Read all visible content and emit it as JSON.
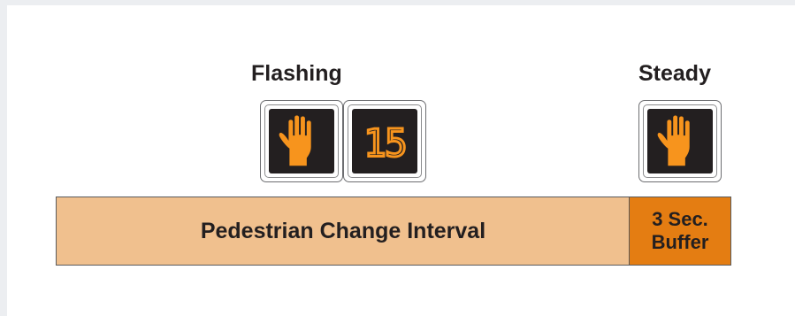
{
  "labels": {
    "flashing": "Flashing",
    "steady": "Steady"
  },
  "countdown": {
    "value": "15"
  },
  "bars": {
    "change_interval": "Pedestrian Change Interval",
    "buffer_line1": "3 Sec.",
    "buffer_line2": "Buffer"
  },
  "colors": {
    "signal_face": "#231f20",
    "indication": "#f7941d",
    "change_interval": "#f0c08e",
    "buffer": "#e47d12"
  },
  "icons": {
    "flashing_hand": "hand-icon",
    "steady_hand": "hand-icon"
  }
}
